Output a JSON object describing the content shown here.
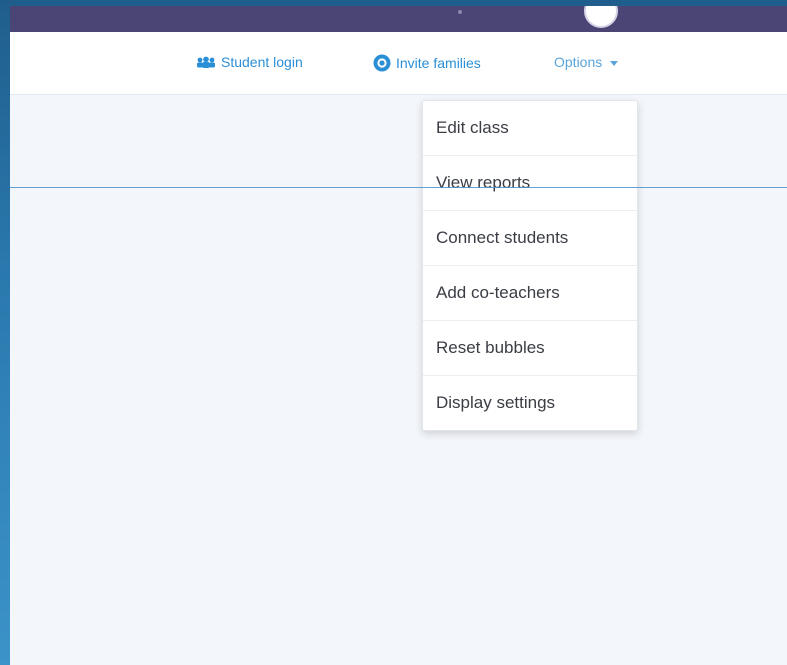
{
  "toolbar": {
    "student_login": {
      "label": "Student login",
      "icon": "students-icon"
    },
    "invite_families": {
      "label": "Invite families",
      "icon": "plus-circle-icon"
    },
    "options": {
      "label": "Options",
      "icon": "chevron-down-icon"
    }
  },
  "options_menu": {
    "items": [
      {
        "label": "Edit class"
      },
      {
        "label": "View reports"
      },
      {
        "label": "Connect students"
      },
      {
        "label": "Add co-teachers"
      },
      {
        "label": "Reset bubbles"
      },
      {
        "label": "Display settings"
      }
    ]
  },
  "colors": {
    "topbar": "#4b4576",
    "accent": "#2b8fd6",
    "background": "#f3f6fb",
    "desktop": "#2a78ad"
  }
}
